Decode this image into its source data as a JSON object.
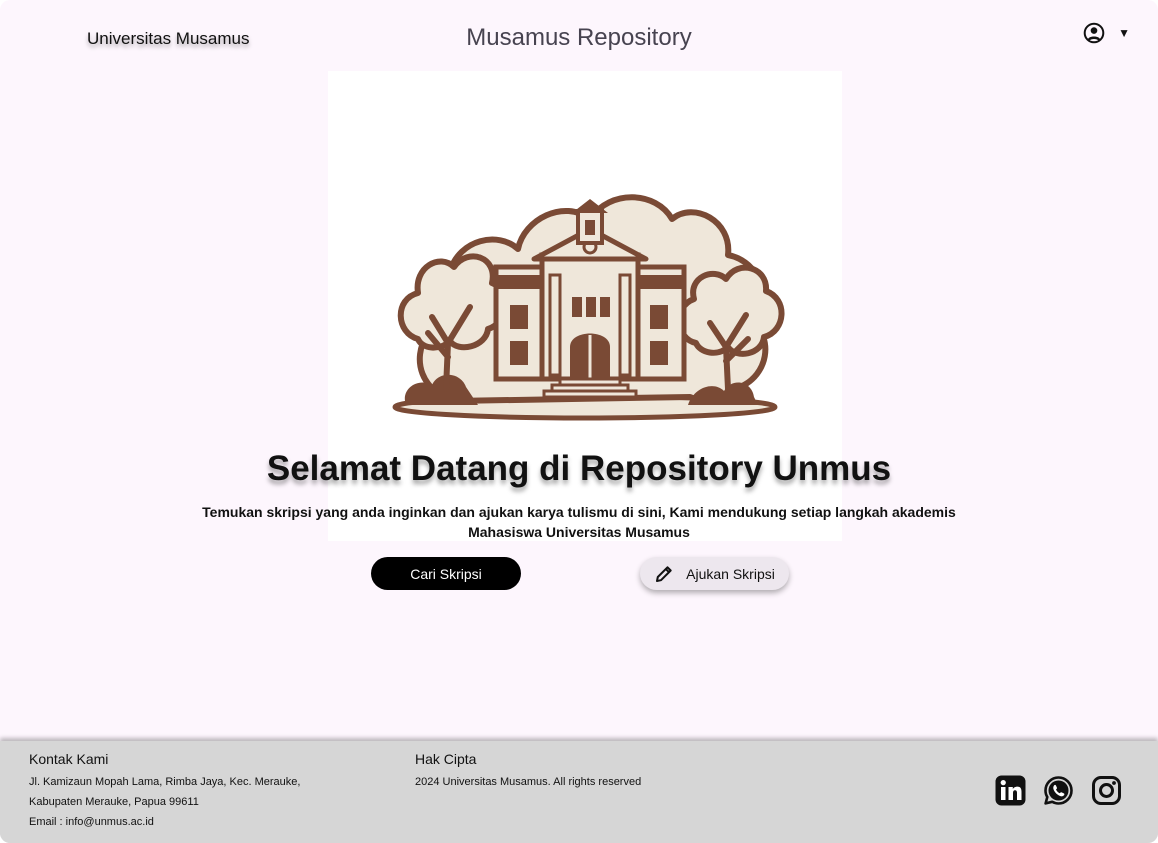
{
  "header": {
    "brand": "Universitas Musamus",
    "title": "Musamus Repository",
    "user_icon": "user-circle-icon",
    "menu_caret": "▼"
  },
  "hero": {
    "illustration": "campus-building-illustration",
    "title": "Selamat Datang di Repository Unmus",
    "subtitle": "Temukan skripsi yang anda inginkan dan ajukan karya tulismu di sini, Kami mendukung setiap langkah akademis Mahasiswa Universitas Musamus",
    "primary_button": "Cari Skripsi",
    "secondary_button": "Ajukan Skripsi",
    "secondary_icon": "pencil-icon"
  },
  "footer": {
    "contact_heading": "Kontak Kami",
    "address_line1": "Jl. Kamizaun Mopah Lama, Rimba Jaya, Kec. Merauke,",
    "address_line2": "Kabupaten Merauke, Papua 99611",
    "email": "Email : info@unmus.ac.id",
    "copyright_heading": "Hak Cipta",
    "copyright_text": "2024 Universitas Musamus. All rights reserved",
    "socials": [
      "linkedin-icon",
      "whatsapp-icon",
      "instagram-icon"
    ]
  },
  "colors": {
    "page_background": "#fdf6fd",
    "footer_background": "#d6d6d6",
    "primary_button": "#000000",
    "illustration_brown": "#7a4a35",
    "illustration_cream": "#efe7da"
  }
}
